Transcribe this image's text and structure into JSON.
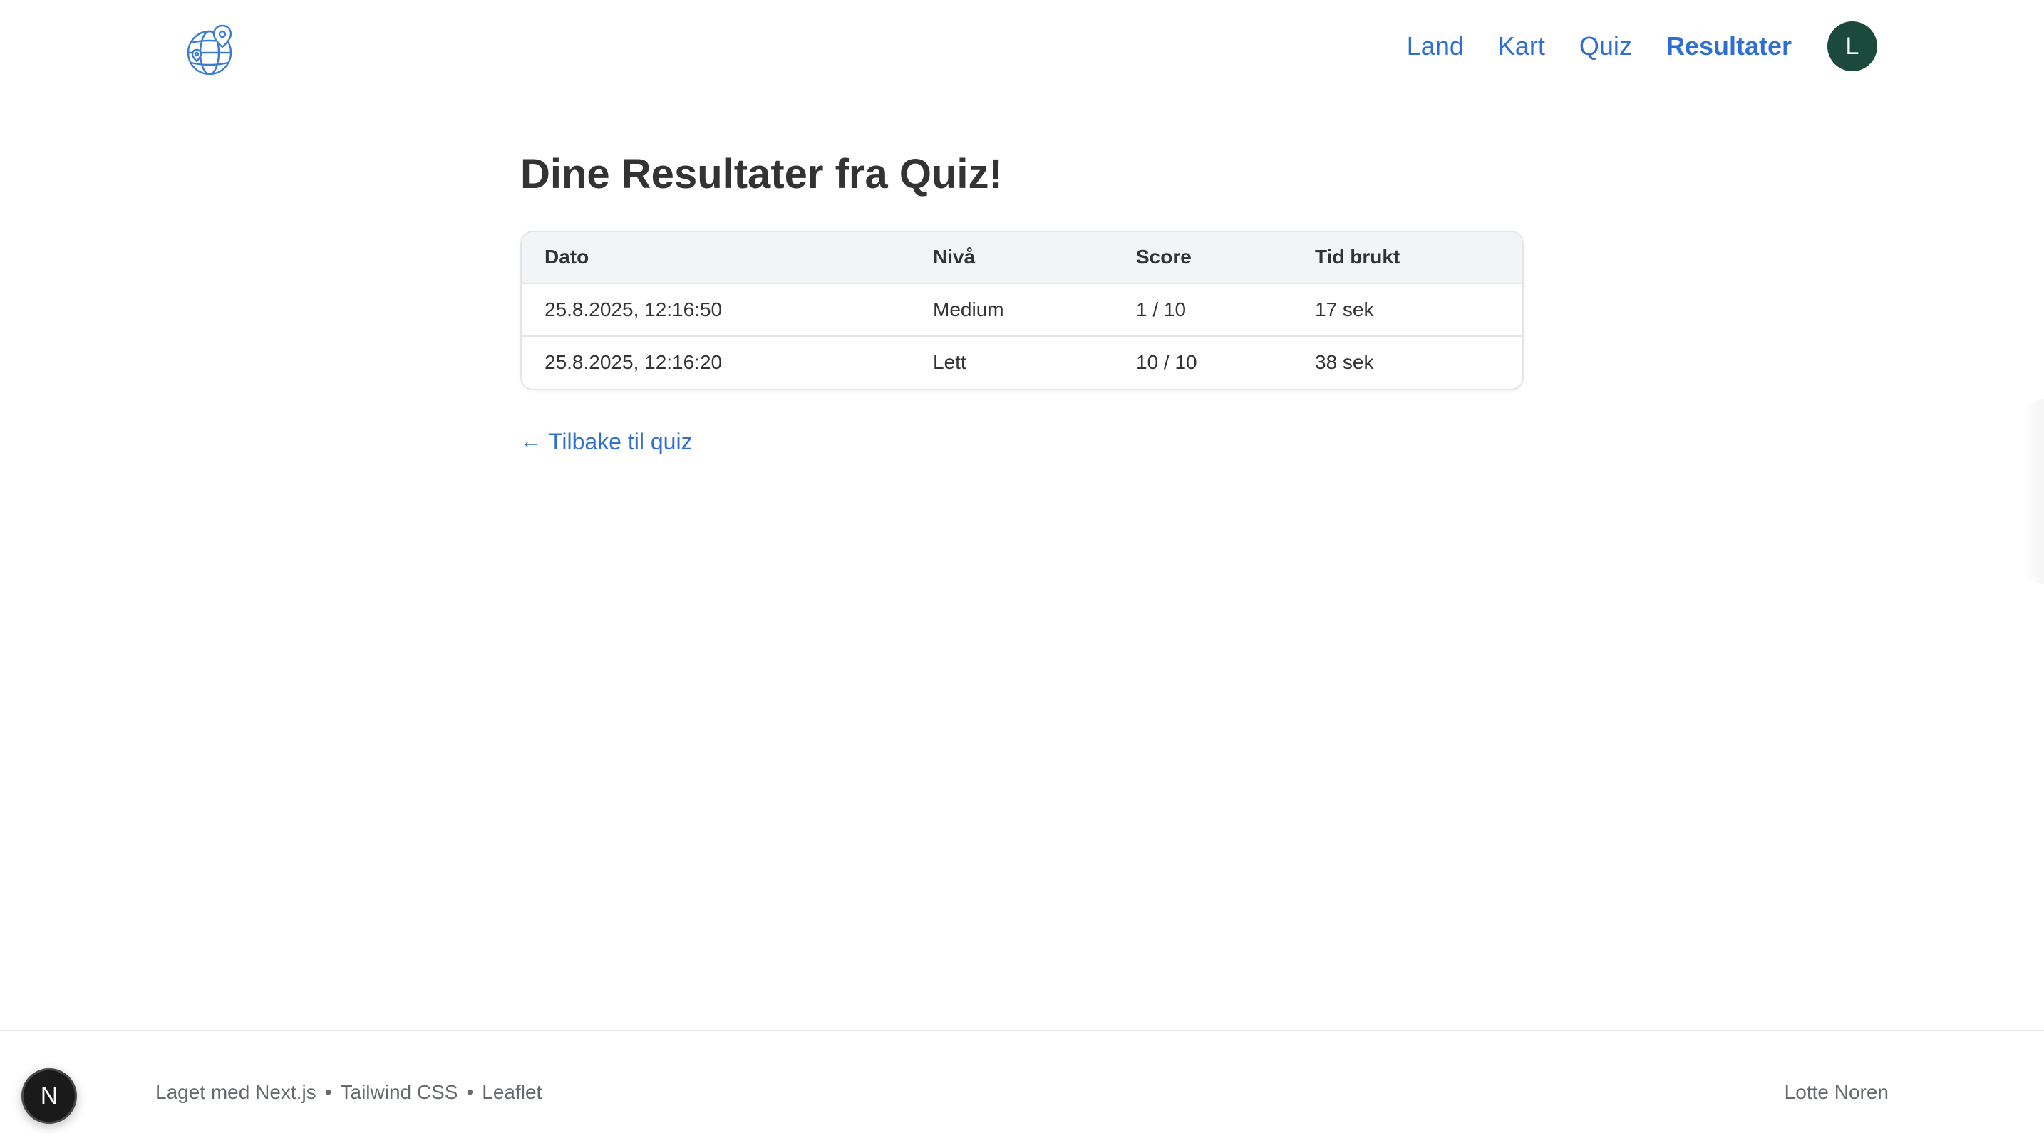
{
  "header": {
    "logo_icon": "globe-pin-icon",
    "nav": [
      {
        "label": "Land",
        "active": false
      },
      {
        "label": "Kart",
        "active": false
      },
      {
        "label": "Quiz",
        "active": false
      },
      {
        "label": "Resultater",
        "active": true
      }
    ],
    "avatar_initial": "L"
  },
  "main": {
    "title": "Dine Resultater fra Quiz!",
    "table": {
      "headers": [
        "Dato",
        "Nivå",
        "Score",
        "Tid brukt"
      ],
      "rows": [
        [
          "25.8.2025, 12:16:50",
          "Medium",
          "1 / 10",
          "17 sek"
        ],
        [
          "25.8.2025, 12:16:20",
          "Lett",
          "10 / 10",
          "38 sek"
        ]
      ]
    },
    "back_link": {
      "arrow": "←",
      "label": "Tilbake til quiz"
    }
  },
  "footer": {
    "left": {
      "prefix": "Laget med",
      "items": [
        "Next.js",
        "Tailwind CSS",
        "Leaflet"
      ],
      "separator": "•"
    },
    "right": "Lotte Noren",
    "badge": "N"
  },
  "colors": {
    "link": "#2f6fd0",
    "avatar_bg": "#1b4a3c",
    "table_header_bg": "#f3f4f6",
    "border": "#e3e5e8"
  }
}
